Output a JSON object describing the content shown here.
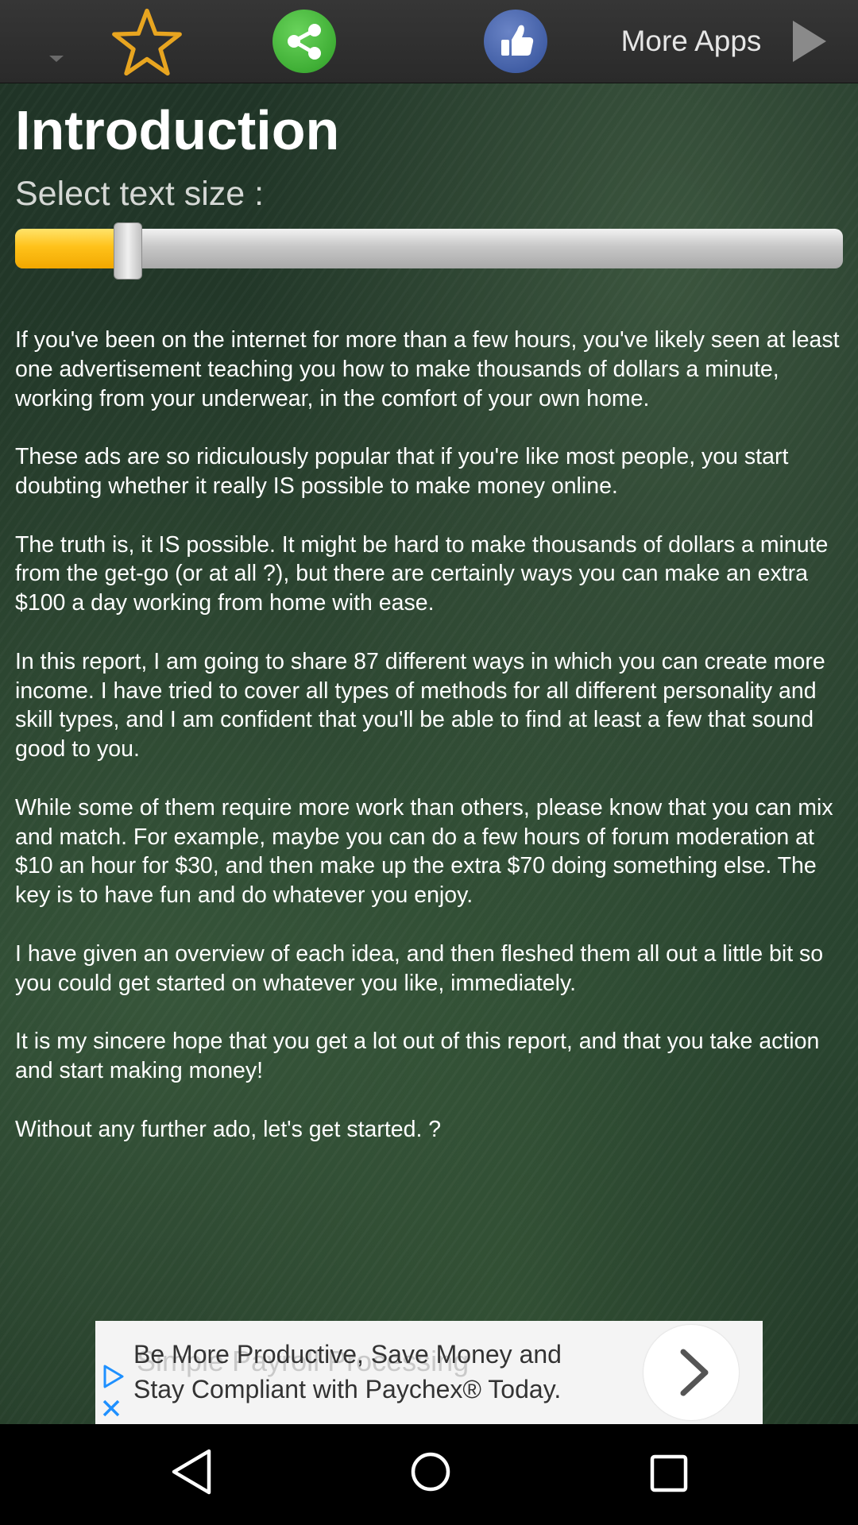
{
  "topbar": {
    "more_apps_label": "More Apps",
    "icons": [
      "dropdown-arrow-icon",
      "star-icon",
      "share-icon",
      "like-icon",
      "play-icon"
    ]
  },
  "page": {
    "title": "Introduction",
    "text_size_label": "Select text size :",
    "text_size_slider": {
      "value_percent": 13.5
    }
  },
  "body_paragraphs": [
    "If you've been on the internet for more than a few hours, you've likely seen at least one advertisement teaching you how to make thousands of dollars a minute, working from your underwear, in the comfort of your own home.",
    "These ads are so ridiculously popular that if you're like most people, you start doubting whether it really IS possible to make money online.",
    "The truth is, it IS possible. It might be hard to make thousands of dollars a minute from the get-go (or at all ?), but there are certainly ways you can make an extra $100 a day working from home with ease.",
    "In this report, I am going to share 87 different ways in which you can create more income. I have tried to cover all types of methods for all different personality and skill types, and I am confident that you'll be able to find at least a few that sound good to you.",
    "While some of them require more work than others, please know that you can mix and match. For example, maybe you can do a few hours of forum moderation at $10 an hour for $30, and then make up the extra $70 doing something else. The key is to have fun and do whatever you enjoy.",
    "I have given an overview of each idea, and then fleshed them all out a little bit so you could get started on whatever you like, immediately.",
    "It is my sincere hope that you get a lot out of this report, and that you take action and start making money!",
    "Without any further ado, let's get started. ?"
  ],
  "ad": {
    "background_text": "Simple Payroll Processing",
    "text": "Be More Productive, Save Money and Stay Compliant with Paychex® Today."
  },
  "colors": {
    "slider_fill": "#ffc21a",
    "share_green": "#3fae35",
    "like_blue": "#3f5ca3",
    "ad_accent": "#1e90ff"
  }
}
